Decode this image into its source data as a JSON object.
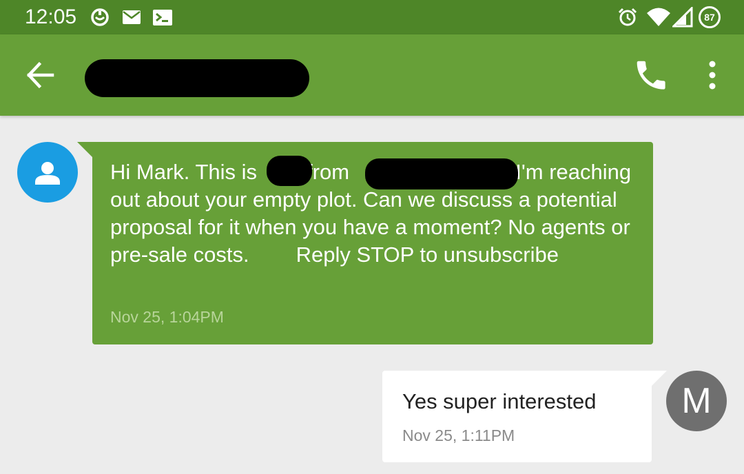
{
  "status_bar": {
    "time": "12:05",
    "battery_level": "87",
    "icons": [
      "smile-notification-icon",
      "mail-icon",
      "terminal-icon",
      "alarm-icon",
      "wifi-icon",
      "signal-icon",
      "battery-icon"
    ]
  },
  "app_bar": {
    "back_icon": "arrow-back-icon",
    "contact_name_redacted": true,
    "call_icon": "phone-icon",
    "more_icon": "more-vert-icon",
    "color": "#67a038"
  },
  "messages": [
    {
      "direction": "incoming",
      "avatar_icon": "person-icon",
      "avatar_color": "#1a9de2",
      "text": {
        "part1": "Hi Mark. This is",
        "part2": "from",
        "part3": ". I'm reaching out about your empty plot. Can we discuss a potential proposal for it when you have a moment? No agents or pre-sale costs.",
        "part4": "Reply STOP to unsubscribe"
      },
      "timestamp": "Nov 25, 1:04PM",
      "bubble_color": "#67a038"
    },
    {
      "direction": "outgoing",
      "avatar_letter": "M",
      "avatar_color": "#6f6f6f",
      "text": "Yes super interested",
      "timestamp": "Nov 25, 1:11PM",
      "bubble_color": "#ffffff"
    }
  ]
}
